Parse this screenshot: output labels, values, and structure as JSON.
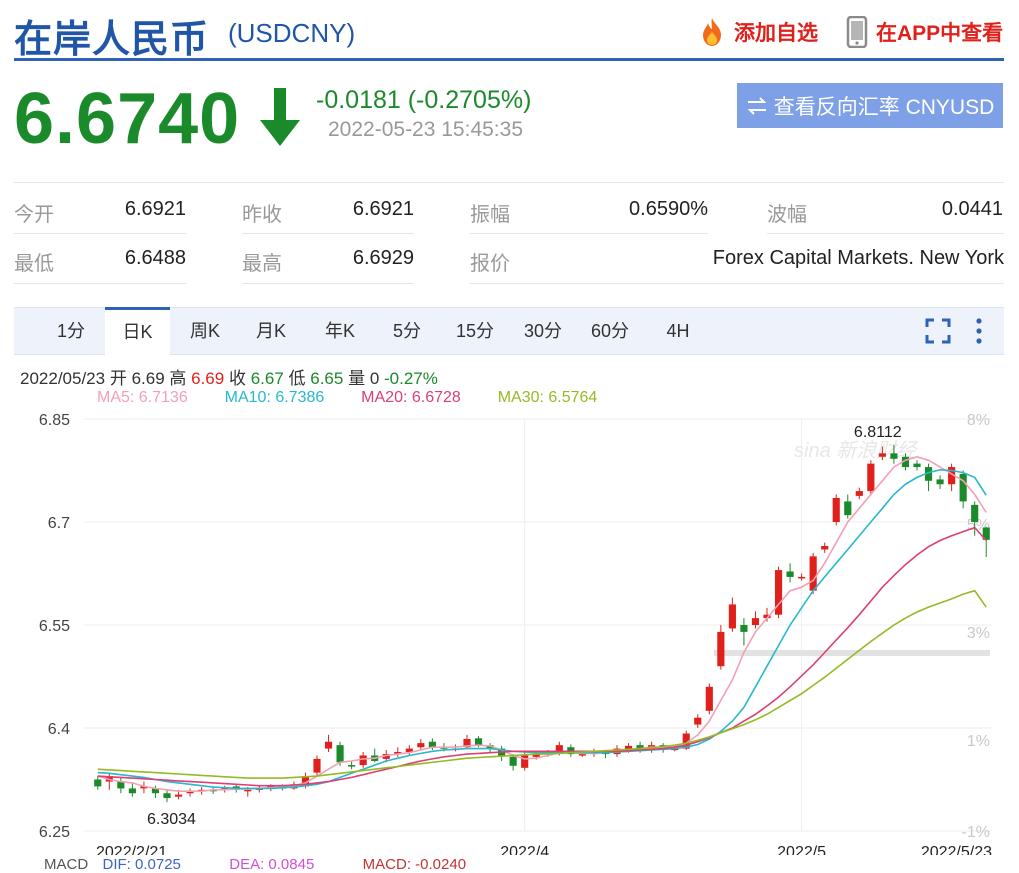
{
  "header": {
    "title": "在岸人民币",
    "symbol": "(USDCNY)",
    "add_watch": "添加自选",
    "view_app": "在APP中查看"
  },
  "quote": {
    "price": "6.6740",
    "change": "-0.0181 (-0.2705%)",
    "timestamp": "2022-05-23 15:45:35",
    "reverse_button": "查看反向汇率 CNYUSD"
  },
  "stats": {
    "open_label": "今开",
    "open_value": "6.6921",
    "prev_close_label": "昨收",
    "prev_close_value": "6.6921",
    "amplitude_label": "振幅",
    "amplitude_value": "0.6590%",
    "wave_label": "波幅",
    "wave_value": "0.0441",
    "low_label": "最低",
    "low_value": "6.6488",
    "high_label": "最高",
    "high_value": "6.6929",
    "quote_label": "报价",
    "quote_value": "Forex Capital Markets. New York"
  },
  "tabs": [
    {
      "label": "1分"
    },
    {
      "label": "日K"
    },
    {
      "label": "周K"
    },
    {
      "label": "月K"
    },
    {
      "label": "年K"
    },
    {
      "label": "5分"
    },
    {
      "label": "15分"
    },
    {
      "label": "30分"
    },
    {
      "label": "60分"
    },
    {
      "label": "4H"
    }
  ],
  "active_tab": "日K",
  "candle_info": {
    "date": "2022/05/23",
    "open_label": "开",
    "open": "6.69",
    "high_label": "高",
    "high": "6.69",
    "close_label": "收",
    "close": "6.67",
    "low_label": "低",
    "low": "6.65",
    "volume_label": "量",
    "volume": "0",
    "pct": "-0.27%"
  },
  "ma_legend": {
    "ma5": "MA5: 6.7136",
    "ma10": "MA10: 6.7386",
    "ma20": "MA20: 6.6728",
    "ma30": "MA30: 6.5764"
  },
  "macd_legend": {
    "label": "MACD",
    "dif": "DIF: 0.0725",
    "dea": "DEA: 0.0845",
    "macd": "MACD: -0.0240"
  },
  "colors": {
    "up": "#e0211b",
    "down": "#1b8a2b",
    "ma5": "#f3a0b5",
    "ma10": "#26b9cc",
    "ma20": "#dc3f73",
    "ma30": "#94bb24"
  },
  "chart_data": {
    "type": "candlestick",
    "ylim": [
      6.25,
      6.85
    ],
    "y_ticks": [
      "6.85",
      "6.7",
      "6.55",
      "6.4",
      "6.25"
    ],
    "pct_ticks": [
      "8%",
      "5%",
      "3%",
      "1%",
      "-1%"
    ],
    "x_ticks": [
      "2022/2/21",
      "2022/4",
      "2022/5",
      "2022/5/23"
    ],
    "max_label": "6.8112",
    "min_label": "6.3034",
    "watermark": "sina 新浪财经",
    "candles": [
      [
        6.325,
        6.315,
        6.33,
        6.31
      ],
      [
        6.322,
        6.33,
        6.335,
        6.31
      ],
      [
        6.322,
        6.312,
        6.328,
        6.305
      ],
      [
        6.312,
        6.305,
        6.32,
        6.3
      ],
      [
        6.312,
        6.315,
        6.322,
        6.305
      ],
      [
        6.312,
        6.305,
        6.316,
        6.298
      ],
      [
        6.305,
        6.298,
        6.31,
        6.292
      ],
      [
        6.3,
        6.303,
        6.31,
        6.296
      ],
      [
        6.305,
        6.308,
        6.312,
        6.3
      ],
      [
        6.308,
        6.31,
        6.314,
        6.303
      ],
      [
        6.31,
        6.308,
        6.315,
        6.304
      ],
      [
        6.31,
        6.312,
        6.316,
        6.306
      ],
      [
        6.315,
        6.31,
        6.318,
        6.306
      ],
      [
        6.308,
        6.31,
        6.314,
        6.3
      ],
      [
        6.31,
        6.312,
        6.316,
        6.306
      ],
      [
        6.312,
        6.315,
        6.318,
        6.308
      ],
      [
        6.314,
        6.312,
        6.318,
        6.309
      ],
      [
        6.312,
        6.318,
        6.322,
        6.31
      ],
      [
        6.315,
        6.33,
        6.335,
        6.312
      ],
      [
        6.335,
        6.355,
        6.36,
        6.33
      ],
      [
        6.37,
        6.38,
        6.39,
        6.365
      ],
      [
        6.375,
        6.35,
        6.38,
        6.345
      ],
      [
        6.346,
        6.345,
        6.352,
        6.34
      ],
      [
        6.346,
        6.36,
        6.365,
        6.342
      ],
      [
        6.36,
        6.352,
        6.37,
        6.35
      ],
      [
        6.355,
        6.362,
        6.368,
        6.35
      ],
      [
        6.362,
        6.365,
        6.372,
        6.358
      ],
      [
        6.365,
        6.37,
        6.375,
        6.36
      ],
      [
        6.372,
        6.378,
        6.384,
        6.368
      ],
      [
        6.38,
        6.372,
        6.385,
        6.368
      ],
      [
        6.372,
        6.37,
        6.378,
        6.366
      ],
      [
        6.37,
        6.37,
        6.376,
        6.366
      ],
      [
        6.372,
        6.384,
        6.39,
        6.37
      ],
      [
        6.385,
        6.375,
        6.388,
        6.372
      ],
      [
        6.375,
        6.37,
        6.378,
        6.365
      ],
      [
        6.37,
        6.36,
        6.374,
        6.352
      ],
      [
        6.358,
        6.345,
        6.362,
        6.338
      ],
      [
        6.342,
        6.36,
        6.365,
        6.338
      ],
      [
        6.358,
        6.362,
        6.366,
        6.354
      ],
      [
        6.362,
        6.364,
        6.368,
        6.358
      ],
      [
        6.364,
        6.375,
        6.38,
        6.36
      ],
      [
        6.372,
        6.362,
        6.376,
        6.358
      ],
      [
        6.362,
        6.362,
        6.366,
        6.358
      ],
      [
        6.362,
        6.365,
        6.37,
        6.358
      ],
      [
        6.365,
        6.362,
        6.368,
        6.356
      ],
      [
        6.362,
        6.37,
        6.375,
        6.358
      ],
      [
        6.368,
        6.374,
        6.378,
        6.364
      ],
      [
        6.375,
        6.368,
        6.38,
        6.364
      ],
      [
        6.368,
        6.375,
        6.38,
        6.364
      ],
      [
        6.375,
        6.368,
        6.378,
        6.364
      ],
      [
        6.37,
        6.37,
        6.376,
        6.366
      ],
      [
        6.37,
        6.392,
        6.396,
        6.368
      ],
      [
        6.405,
        6.415,
        6.42,
        6.4
      ],
      [
        6.425,
        6.46,
        6.465,
        6.42
      ],
      [
        6.49,
        6.54,
        6.55,
        6.485
      ],
      [
        6.545,
        6.58,
        6.59,
        6.54
      ],
      [
        6.55,
        6.54,
        6.56,
        6.52
      ],
      [
        6.55,
        6.56,
        6.57,
        6.545
      ],
      [
        6.56,
        6.565,
        6.575,
        6.555
      ],
      [
        6.565,
        6.63,
        6.635,
        6.56
      ],
      [
        6.628,
        6.62,
        6.64,
        6.612
      ],
      [
        6.62,
        6.62,
        6.625,
        6.615
      ],
      [
        6.6,
        6.65,
        6.655,
        6.595
      ],
      [
        6.66,
        6.665,
        6.67,
        6.655
      ],
      [
        6.7,
        6.735,
        6.74,
        6.695
      ],
      [
        6.73,
        6.71,
        6.74,
        6.705
      ],
      [
        6.738,
        6.745,
        6.75,
        6.733
      ],
      [
        6.745,
        6.785,
        6.79,
        6.74
      ],
      [
        6.795,
        6.8,
        6.81,
        6.79
      ],
      [
        6.8,
        6.792,
        6.812,
        6.785
      ],
      [
        6.795,
        6.78,
        6.8,
        6.775
      ],
      [
        6.785,
        6.78,
        6.79,
        6.775
      ],
      [
        6.78,
        6.76,
        6.785,
        6.745
      ],
      [
        6.762,
        6.755,
        6.768,
        6.748
      ],
      [
        6.755,
        6.78,
        6.785,
        6.745
      ],
      [
        6.77,
        6.73,
        6.775,
        6.72
      ],
      [
        6.725,
        6.7,
        6.73,
        6.68
      ],
      [
        6.692,
        6.674,
        6.693,
        6.649
      ]
    ],
    "series": [
      {
        "name": "MA5",
        "values": [
          6.33,
          6.325,
          6.322,
          6.32,
          6.315,
          6.312,
          6.31,
          6.308,
          6.308,
          6.308,
          6.31,
          6.31,
          6.311,
          6.311,
          6.312,
          6.313,
          6.314,
          6.316,
          6.32,
          6.33,
          6.34,
          6.35,
          6.352,
          6.355,
          6.356,
          6.36,
          6.362,
          6.364,
          6.368,
          6.372,
          6.372,
          6.372,
          6.374,
          6.375,
          6.374,
          6.368,
          6.36,
          6.355,
          6.356,
          6.36,
          6.364,
          6.364,
          6.363,
          6.363,
          6.364,
          6.365,
          6.366,
          6.37,
          6.372,
          6.372,
          6.372,
          6.378,
          6.39,
          6.41,
          6.44,
          6.47,
          6.51,
          6.54,
          6.56,
          6.58,
          6.6,
          6.605,
          6.615,
          6.64,
          6.67,
          6.7,
          6.72,
          6.74,
          6.76,
          6.78,
          6.79,
          6.795,
          6.79,
          6.78,
          6.77,
          6.76,
          6.74,
          6.714
        ]
      },
      {
        "name": "MA10",
        "values": [
          6.335,
          6.334,
          6.332,
          6.33,
          6.328,
          6.325,
          6.322,
          6.32,
          6.318,
          6.316,
          6.314,
          6.313,
          6.312,
          6.312,
          6.312,
          6.312,
          6.313,
          6.314,
          6.316,
          6.318,
          6.322,
          6.328,
          6.334,
          6.34,
          6.346,
          6.352,
          6.356,
          6.36,
          6.363,
          6.366,
          6.368,
          6.369,
          6.37,
          6.37,
          6.37,
          6.368,
          6.366,
          6.365,
          6.364,
          6.364,
          6.364,
          6.364,
          6.364,
          6.364,
          6.364,
          6.365,
          6.366,
          6.367,
          6.368,
          6.369,
          6.37,
          6.372,
          6.376,
          6.384,
          6.395,
          6.41,
          6.43,
          6.46,
          6.49,
          6.52,
          6.55,
          6.575,
          6.6,
          6.62,
          6.64,
          6.66,
          6.68,
          6.7,
          6.72,
          6.74,
          6.755,
          6.765,
          6.772,
          6.776,
          6.775,
          6.772,
          6.765,
          6.739
        ]
      },
      {
        "name": "MA20",
        "values": [
          6.33,
          6.329,
          6.328,
          6.327,
          6.326,
          6.325,
          6.324,
          6.323,
          6.322,
          6.321,
          6.32,
          6.319,
          6.318,
          6.317,
          6.316,
          6.316,
          6.316,
          6.317,
          6.318,
          6.32,
          6.322,
          6.325,
          6.328,
          6.332,
          6.336,
          6.34,
          6.344,
          6.348,
          6.352,
          6.355,
          6.358,
          6.36,
          6.362,
          6.363,
          6.364,
          6.365,
          6.366,
          6.366,
          6.366,
          6.366,
          6.366,
          6.366,
          6.366,
          6.366,
          6.366,
          6.366,
          6.367,
          6.368,
          6.369,
          6.37,
          6.372,
          6.375,
          6.38,
          6.386,
          6.393,
          6.4,
          6.41,
          6.42,
          6.432,
          6.445,
          6.46,
          6.476,
          6.492,
          6.51,
          6.528,
          6.546,
          6.565,
          6.585,
          6.605,
          6.622,
          6.638,
          6.652,
          6.664,
          6.673,
          6.68,
          6.686,
          6.692,
          6.673
        ]
      },
      {
        "name": "MA30",
        "values": [
          6.34,
          6.339,
          6.338,
          6.337,
          6.336,
          6.335,
          6.334,
          6.333,
          6.332,
          6.331,
          6.33,
          6.329,
          6.328,
          6.327,
          6.327,
          6.327,
          6.327,
          6.328,
          6.329,
          6.33,
          6.332,
          6.334,
          6.336,
          6.338,
          6.34,
          6.342,
          6.344,
          6.346,
          6.348,
          6.35,
          6.352,
          6.354,
          6.356,
          6.357,
          6.358,
          6.359,
          6.36,
          6.361,
          6.362,
          6.362,
          6.363,
          6.364,
          6.365,
          6.366,
          6.367,
          6.368,
          6.369,
          6.37,
          6.371,
          6.373,
          6.375,
          6.378,
          6.382,
          6.387,
          6.393,
          6.399,
          6.405,
          6.412,
          6.42,
          6.43,
          6.44,
          6.45,
          6.462,
          6.474,
          6.487,
          6.5,
          6.513,
          6.526,
          6.538,
          6.55,
          6.56,
          6.569,
          6.576,
          6.582,
          6.588,
          6.595,
          6.6,
          6.576
        ]
      }
    ]
  }
}
